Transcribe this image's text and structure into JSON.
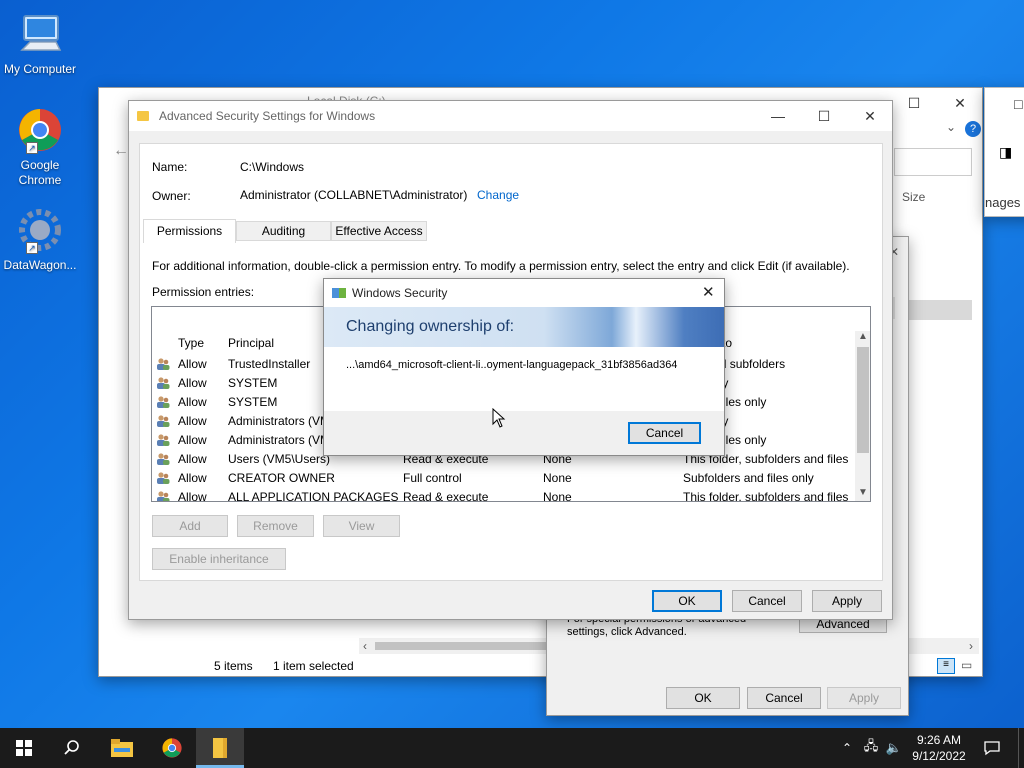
{
  "desktop": {
    "icons": [
      {
        "label": "My Computer"
      },
      {
        "label": "Google Chrome"
      },
      {
        "label": "DataWagon..."
      }
    ]
  },
  "explorer": {
    "title": "Local Disk (C:)",
    "size_header": "Size",
    "images_label": "nages",
    "status_items": "5 items",
    "status_selected": "1 item selected"
  },
  "properties": {
    "advanced_hint": "For special permissions or advanced settings, click Advanced.",
    "advanced_btn": "Advanced",
    "ok": "OK",
    "cancel": "Cancel",
    "apply": "Apply"
  },
  "advanced": {
    "title": "Advanced Security Settings for Windows",
    "name_label": "Name:",
    "name_value": "C:\\Windows",
    "owner_label": "Owner:",
    "owner_value": "Administrator (COLLABNET\\Administrator)",
    "change_link": "Change",
    "tabs": [
      {
        "label": "Permissions",
        "active": true
      },
      {
        "label": "Auditing"
      },
      {
        "label": "Effective Access"
      }
    ],
    "info": "For additional information, double-click a permission entry. To modify a permission entry, select the entry and click Edit (if available).",
    "entries_label": "Permission entries:",
    "columns": {
      "type": "Type",
      "principal": "Principal",
      "applies": "to"
    },
    "rows": [
      {
        "type": "Allow",
        "principal": "TrustedInstaller",
        "access": "",
        "inherited": "",
        "applies": "lder and subfolders"
      },
      {
        "type": "Allow",
        "principal": "SYSTEM",
        "access": "",
        "inherited": "",
        "applies": "lder only"
      },
      {
        "type": "Allow",
        "principal": "SYSTEM",
        "access": "",
        "inherited": "",
        "applies": "rs and files only"
      },
      {
        "type": "Allow",
        "principal": "Administrators (VM",
        "access": "",
        "inherited": "",
        "applies": "lder only"
      },
      {
        "type": "Allow",
        "principal": "Administrators (VM",
        "access": "",
        "inherited": "",
        "applies": "rs and files only"
      },
      {
        "type": "Allow",
        "principal": "Users (VM5\\Users)",
        "access": "Read & execute",
        "inherited": "None",
        "applies": "This folder, subfolders and files"
      },
      {
        "type": "Allow",
        "principal": "CREATOR OWNER",
        "access": "Full control",
        "inherited": "None",
        "applies": "Subfolders and files only"
      },
      {
        "type": "Allow",
        "principal": "ALL APPLICATION PACKAGES",
        "access": "Read & execute",
        "inherited": "None",
        "applies": "This folder, subfolders and files"
      }
    ],
    "add_btn": "Add",
    "remove_btn": "Remove",
    "view_btn": "View",
    "inherit_btn": "Enable inheritance",
    "ok": "OK",
    "cancel": "Cancel",
    "apply": "Apply"
  },
  "security_dialog": {
    "title": "Windows Security",
    "heading": "Changing ownership of:",
    "path": "...\\amd64_microsoft-client-li..oyment-languagepack_31bf3856ad364",
    "cancel": "Cancel"
  },
  "taskbar": {
    "time": "9:26 AM",
    "date": "9/12/2022"
  }
}
